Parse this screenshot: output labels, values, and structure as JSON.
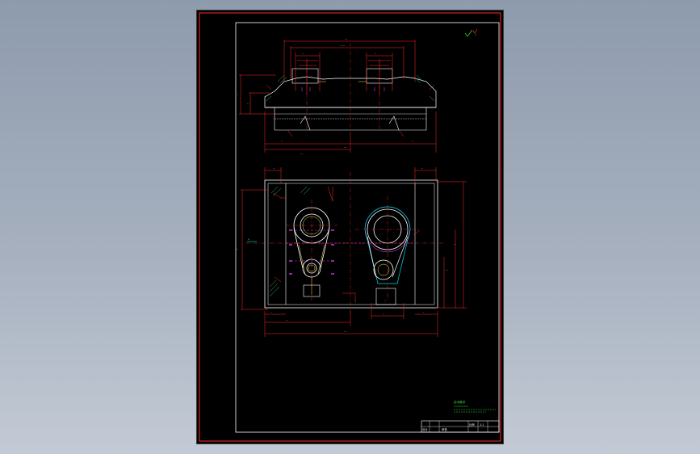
{
  "drawing": {
    "sheet_background": "#000000",
    "page_background": "#9aa6b6",
    "colors": {
      "outline": "#ffffff",
      "dimension": "#ff2a2a",
      "centerline": "#ff2a2a",
      "hidden": "#ff40ff",
      "hatch": "#2fbf4a",
      "cyan": "#00d7e8",
      "yellow": "#ffe24a",
      "text": "#e8e8e8",
      "green_note": "#3ad83a"
    },
    "title_block": {
      "cells": [
        "设计",
        "审核",
        "比例",
        "1:1"
      ]
    },
    "notes": {
      "technical_requirements": "技术要求"
    },
    "icons": [
      "roughness-symbol-icon",
      "section-arrow-icon"
    ]
  }
}
